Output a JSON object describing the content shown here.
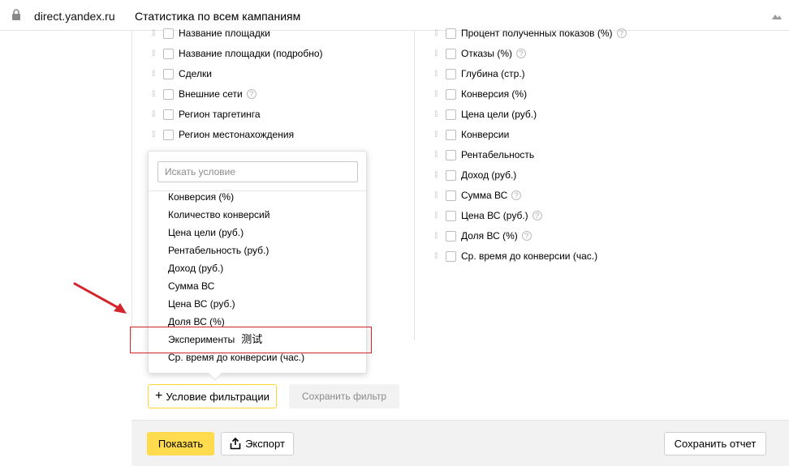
{
  "browser": {
    "domain": "direct.yandex.ru",
    "page_title": "Статистика по всем кампаниям"
  },
  "left_column": [
    {
      "label": "Название площадки",
      "help": false
    },
    {
      "label": "Название площадки (подробно)",
      "help": false
    },
    {
      "label": "Сделки",
      "help": false
    },
    {
      "label": "Внешние сети",
      "help": true
    },
    {
      "label": "Регион таргетинга",
      "help": false
    },
    {
      "label": "Регион местонахождения",
      "help": false
    }
  ],
  "right_column": [
    {
      "label": "Процент полученных показов (%)",
      "help": true
    },
    {
      "label": "Отказы (%)",
      "help": true
    },
    {
      "label": "Глубина (стр.)",
      "help": false
    },
    {
      "label": "Конверсия (%)",
      "help": false
    },
    {
      "label": "Цена цели (руб.)",
      "help": false
    },
    {
      "label": "Конверсии",
      "help": false
    },
    {
      "label": "Рентабельность",
      "help": false
    },
    {
      "label": "Доход (руб.)",
      "help": false
    },
    {
      "label": "Сумма ВС",
      "help": true
    },
    {
      "label": "Цена ВС (руб.)",
      "help": true
    },
    {
      "label": "Доля ВС (%)",
      "help": true
    },
    {
      "label": "Ср. время до конверсии (час.)",
      "help": false
    }
  ],
  "dropdown": {
    "search_placeholder": "Искать условие",
    "items": [
      "Конверсия (%)",
      "Количество конверсий",
      "Цена цели (руб.)",
      "Рентабельность (руб.)",
      "Доход (руб.)",
      "Сумма ВС",
      "Цена ВС (руб.)",
      "Доля ВС (%)",
      "Эксперименты",
      "Ср. время до конверсии (час.)"
    ],
    "highlight_annotation": "测试"
  },
  "filter": {
    "add_condition_label": "Условие фильтрации",
    "save_filter_label": "Сохранить фильтр"
  },
  "toolbar": {
    "show_label": "Показать",
    "export_label": "Экспорт",
    "save_report_label": "Сохранить отчет"
  },
  "colors": {
    "accent_yellow": "#ffdb4d",
    "highlight_red": "#d4242b"
  }
}
